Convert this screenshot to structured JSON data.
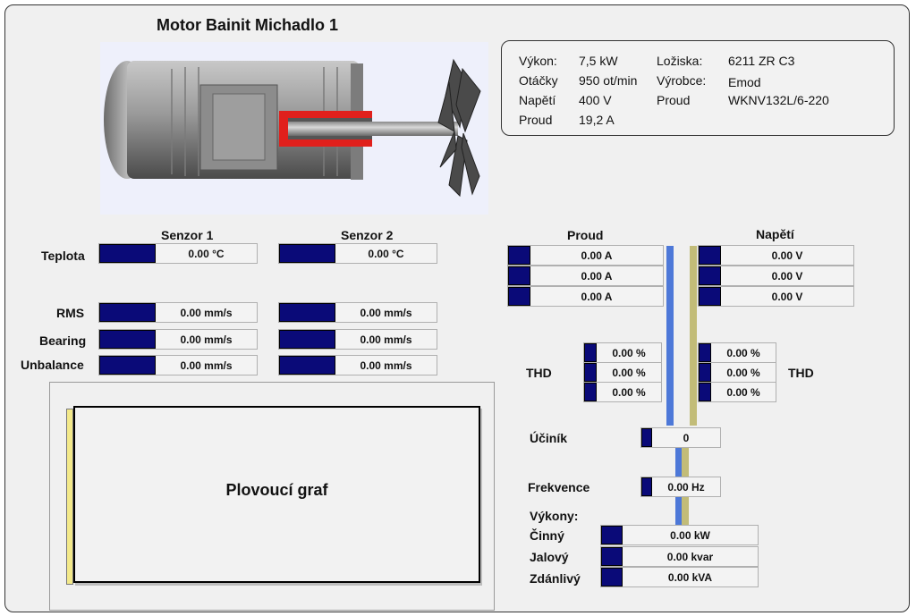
{
  "title": "Motor Bainit Michadlo 1",
  "specs": {
    "power_label": "Výkon:",
    "power_value": "7,5 kW",
    "rpm_label": "Otáčky",
    "rpm_value": "950 ot/min",
    "voltage_label": "Napětí",
    "voltage_value": "400 V",
    "current_label": "Proud",
    "current_value": "19,2 A",
    "bearings_label": "Ložiska:",
    "bearings_value": "6211 ZR C3",
    "maker_label": "Výrobce:",
    "maker_value": "Emod",
    "type_label": "Proud",
    "type_value": "WKNV132L/6-220"
  },
  "sensors": {
    "sensor1_header": "Senzor 1",
    "sensor2_header": "Senzor 2",
    "rows": [
      {
        "label": "Teplota",
        "s1": "0.00 °C",
        "s2": "0.00 °C"
      },
      {
        "label": "RMS",
        "s1": "0.00 mm/s",
        "s2": "0.00 mm/s"
      },
      {
        "label": "Bearing",
        "s1": "0.00 mm/s",
        "s2": "0.00 mm/s"
      },
      {
        "label": "Unbalance",
        "s1": "0.00 mm/s",
        "s2": "0.00 mm/s"
      }
    ]
  },
  "electrical": {
    "current_header": "Proud",
    "voltage_header": "Napětí",
    "currents": [
      "0.00 A",
      "0.00 A",
      "0.00 A"
    ],
    "voltages": [
      "0.00 V",
      "0.00 V",
      "0.00 V"
    ],
    "thd_label_left": "THD",
    "thd_label_right": "THD",
    "thd_current": [
      "0.00 %",
      "0.00 %",
      "0.00 %"
    ],
    "thd_voltage": [
      "0.00 %",
      "0.00 %",
      "0.00 %"
    ],
    "pf_label": "Účiník",
    "pf_value": "0",
    "freq_label": "Frekvence",
    "freq_value": "0.00 Hz",
    "powers_label": "Výkony:",
    "active_label": "Činný",
    "active_value": "0.00 kW",
    "reactive_label": "Jalový",
    "reactive_value": "0.00 kvar",
    "apparent_label": "Zdánlivý",
    "apparent_value": "0.00 kVA"
  },
  "graph": {
    "label": "Plovoucí graf"
  },
  "colors": {
    "indicator": "#0a0a78",
    "bar_current": "#4d78d8",
    "bar_voltage": "#c2bc78",
    "shaft_collar": "#e0201c"
  }
}
